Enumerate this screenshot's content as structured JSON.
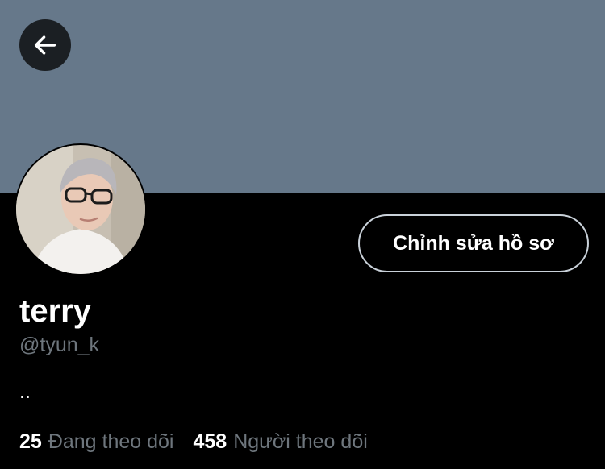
{
  "colors": {
    "banner": "#66788a",
    "background": "#000000",
    "text_primary": "#ffffff",
    "text_secondary": "#6e767d",
    "button_border": "#c9d1d9"
  },
  "header": {
    "back_icon": "arrow-left-icon"
  },
  "profile": {
    "display_name": "terry",
    "handle": "@tyun_k",
    "bio": "..",
    "edit_button_label": "Chỉnh sửa hồ sơ"
  },
  "stats": {
    "following_count": "25",
    "following_label": "Đang theo dõi",
    "followers_count": "458",
    "followers_label": "Người theo dõi"
  }
}
